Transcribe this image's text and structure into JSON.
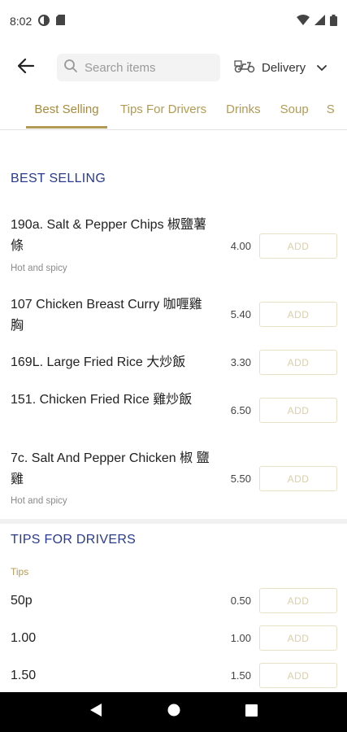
{
  "status_bar": {
    "time": "8:02"
  },
  "search": {
    "placeholder": "Search items"
  },
  "delivery": {
    "label": "Delivery"
  },
  "tabs": [
    {
      "label": "Best Selling",
      "active": true
    },
    {
      "label": "Tips For Drivers"
    },
    {
      "label": "Drinks"
    },
    {
      "label": "Soup"
    },
    {
      "label": "S"
    }
  ],
  "sections": [
    {
      "title": "BEST SELLING",
      "items": [
        {
          "name": "190a. Salt & Pepper Chips 椒鹽薯條",
          "description": "Hot and spicy",
          "price": "4.00",
          "button": "ADD"
        },
        {
          "name": "107 Chicken Breast Curry 咖喱雞胸",
          "price": "5.40",
          "button": "ADD"
        },
        {
          "name": "169L. Large Fried Rice 大炒飯",
          "price": "3.30",
          "button": "ADD"
        },
        {
          "name": "151. Chicken Fried Rice 雞炒飯",
          "price": "6.50",
          "button": "ADD"
        },
        {
          "name": "7c. Salt And Pepper Chicken 椒 鹽 雞",
          "description": "Hot and spicy",
          "price": "5.50",
          "button": "ADD"
        }
      ]
    },
    {
      "title": "TIPS FOR DRIVERS",
      "subtitle": "Tips",
      "items": [
        {
          "name": "50p",
          "price": "0.50",
          "button": "ADD"
        },
        {
          "name": "1.00",
          "price": "1.00",
          "button": "ADD"
        },
        {
          "name": "1.50",
          "price": "1.50",
          "button": "ADD"
        }
      ]
    }
  ],
  "colors": {
    "accent_gold": "#b39a54",
    "section_blue": "#283a8f",
    "add_border": "#e8e1c6"
  }
}
